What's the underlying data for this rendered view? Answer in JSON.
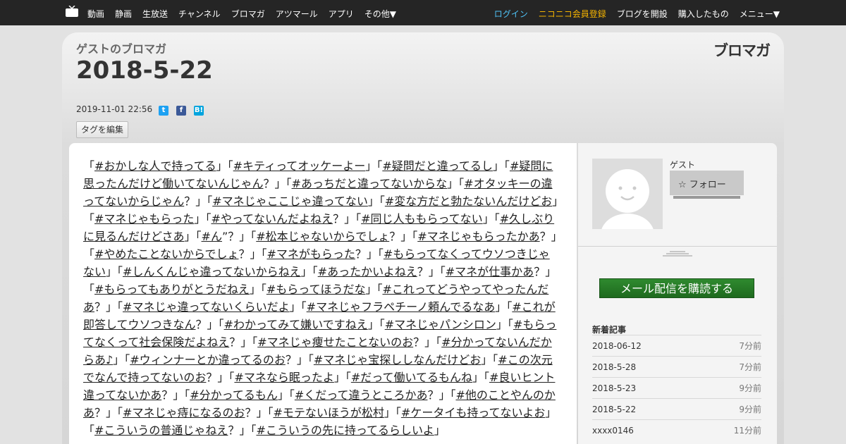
{
  "topbar": {
    "nav_left": [
      "動画",
      "静画",
      "生放送",
      "チャンネル",
      "ブロマガ",
      "アツマール",
      "アプリ",
      "その他▼"
    ],
    "login": "ログイン",
    "register": "ニコニコ会員登録",
    "open_blog": "ブログを開設",
    "purchased": "購入したもの",
    "menu": "メニュー▼",
    "colors": {
      "login": "#4fc3f7",
      "register": "#f5b400"
    }
  },
  "blog": {
    "name": "ゲストのブロマガ",
    "logo": "ブロマガ",
    "title": "2018-5-22",
    "date": "2019-11-01 22:56",
    "tag_edit": "タグを編集"
  },
  "article": {
    "segments": [
      {
        "t": "「"
      },
      {
        "t": "#おかしな人で持ってる",
        "tag": true
      },
      {
        "t": "」「"
      },
      {
        "t": "#キティってオッケーよー",
        "tag": true
      },
      {
        "t": "」「"
      },
      {
        "t": "#疑問だと違ってるし",
        "tag": true
      },
      {
        "t": "」「"
      },
      {
        "t": "#疑問に思ったんだけど働いてないんじゃん",
        "tag": true
      },
      {
        "t": "？」「"
      },
      {
        "t": "#あっちだと違ってないからな",
        "tag": true
      },
      {
        "t": "」「"
      },
      {
        "t": "#オタッキーの違ってないからじゃん",
        "tag": true
      },
      {
        "t": "？」「"
      },
      {
        "t": "#マネじゃここじゃ違ってない",
        "tag": true
      },
      {
        "t": "」「"
      },
      {
        "t": "#変な方だと勃たないんだけどお",
        "tag": true
      },
      {
        "t": "」「"
      },
      {
        "t": "#マネじゃもらった",
        "tag": true
      },
      {
        "t": "」「"
      },
      {
        "t": "#やってないんだよねえ",
        "tag": true
      },
      {
        "t": "？」「"
      },
      {
        "t": "#同じ人ももらってない",
        "tag": true
      },
      {
        "t": "」「"
      },
      {
        "t": "#久しぶりに見るんだけどさあ",
        "tag": true
      },
      {
        "t": "」「"
      },
      {
        "t": "#ん",
        "tag": true
      },
      {
        "t": "”？」「"
      },
      {
        "t": "#松本じゃないからでしょ",
        "tag": true
      },
      {
        "t": "？」「"
      },
      {
        "t": "#マネじゃもらったかあ",
        "tag": true
      },
      {
        "t": "？」「"
      },
      {
        "t": "#やめたことないからでしょ",
        "tag": true
      },
      {
        "t": "？」「"
      },
      {
        "t": "#マネがもらった",
        "tag": true
      },
      {
        "t": "？」「"
      },
      {
        "t": "#もらってなくってウソつきじゃない",
        "tag": true
      },
      {
        "t": "」「"
      },
      {
        "t": "#しんくんじゃ違ってないからねえ",
        "tag": true
      },
      {
        "t": "」「"
      },
      {
        "t": "#あったかいよねえ",
        "tag": true
      },
      {
        "t": "？」「"
      },
      {
        "t": "#マネが仕事かあ",
        "tag": true
      },
      {
        "t": "？」「"
      },
      {
        "t": "#もらってもありがとうだねえ",
        "tag": true
      },
      {
        "t": "」「"
      },
      {
        "t": "#もらってほうだな",
        "tag": true
      },
      {
        "t": "」「"
      },
      {
        "t": "#これってどうやってやったんだあ",
        "tag": true
      },
      {
        "t": "？」「"
      },
      {
        "t": "#マネじゃ違ってないくらいだよ",
        "tag": true
      },
      {
        "t": "」「"
      },
      {
        "t": "#マネじゃフラペチーノ頼んでるなあ",
        "tag": true
      },
      {
        "t": "」「"
      },
      {
        "t": "#これが即答してウソつきなん",
        "tag": true
      },
      {
        "t": "？」「"
      },
      {
        "t": "#わかってみて嫌いですねえ",
        "tag": true
      },
      {
        "t": "」「"
      },
      {
        "t": "#マネじゃパンシロン",
        "tag": true
      },
      {
        "t": "」「"
      },
      {
        "t": "#もらってなくって社会保険だよねえ",
        "tag": true
      },
      {
        "t": "？」「"
      },
      {
        "t": "#マネじゃ痩せたことないのお",
        "tag": true
      },
      {
        "t": "？」「"
      },
      {
        "t": "#分かってないんだからあ♪",
        "tag": true
      },
      {
        "t": "」「"
      },
      {
        "t": "#ウィンナーとか違ってるのお",
        "tag": true
      },
      {
        "t": "？」「"
      },
      {
        "t": "#マネじゃ宝探ししなんだけどお",
        "tag": true
      },
      {
        "t": "」「"
      },
      {
        "t": "#この次元でなんで持ってないのお",
        "tag": true
      },
      {
        "t": "？」「"
      },
      {
        "t": "#マネなら眠ったよ",
        "tag": true
      },
      {
        "t": "」「"
      },
      {
        "t": "#だって働いてるもんね",
        "tag": true
      },
      {
        "t": "」「"
      },
      {
        "t": "#良いヒント違ってないかあ",
        "tag": true
      },
      {
        "t": "？」「"
      },
      {
        "t": "#分かってるもん",
        "tag": true
      },
      {
        "t": "」「"
      },
      {
        "t": "#くだって違うところかあ",
        "tag": true
      },
      {
        "t": "？」「"
      },
      {
        "t": "#他のことやんのかあ",
        "tag": true
      },
      {
        "t": "？」「"
      },
      {
        "t": "#マネじゃ痔になるのお",
        "tag": true
      },
      {
        "t": "？」「"
      },
      {
        "t": "#モテないほうが松村",
        "tag": true
      },
      {
        "t": "」「"
      },
      {
        "t": "#ケータイも持ってないよお",
        "tag": true
      },
      {
        "t": "」「"
      },
      {
        "t": "#こういうの普通じゃねえ",
        "tag": true
      },
      {
        "t": "？」「"
      },
      {
        "t": "#こういうの先に持ってるらしいよ",
        "tag": true
      },
      {
        "t": "」"
      }
    ]
  },
  "sidebar": {
    "profile_name": "ゲスト",
    "follow": "フォロー",
    "subscribe": "メール配信を購読する",
    "recent_title": "新着記事",
    "recent": [
      {
        "title": "2018-06-12",
        "ago": "7分前"
      },
      {
        "title": "2018-5-28",
        "ago": "7分前"
      },
      {
        "title": "2018-5-23",
        "ago": "9分前"
      },
      {
        "title": "2018-5-22",
        "ago": "9分前"
      },
      {
        "title": "xxxx0146",
        "ago": "11分前"
      }
    ]
  }
}
